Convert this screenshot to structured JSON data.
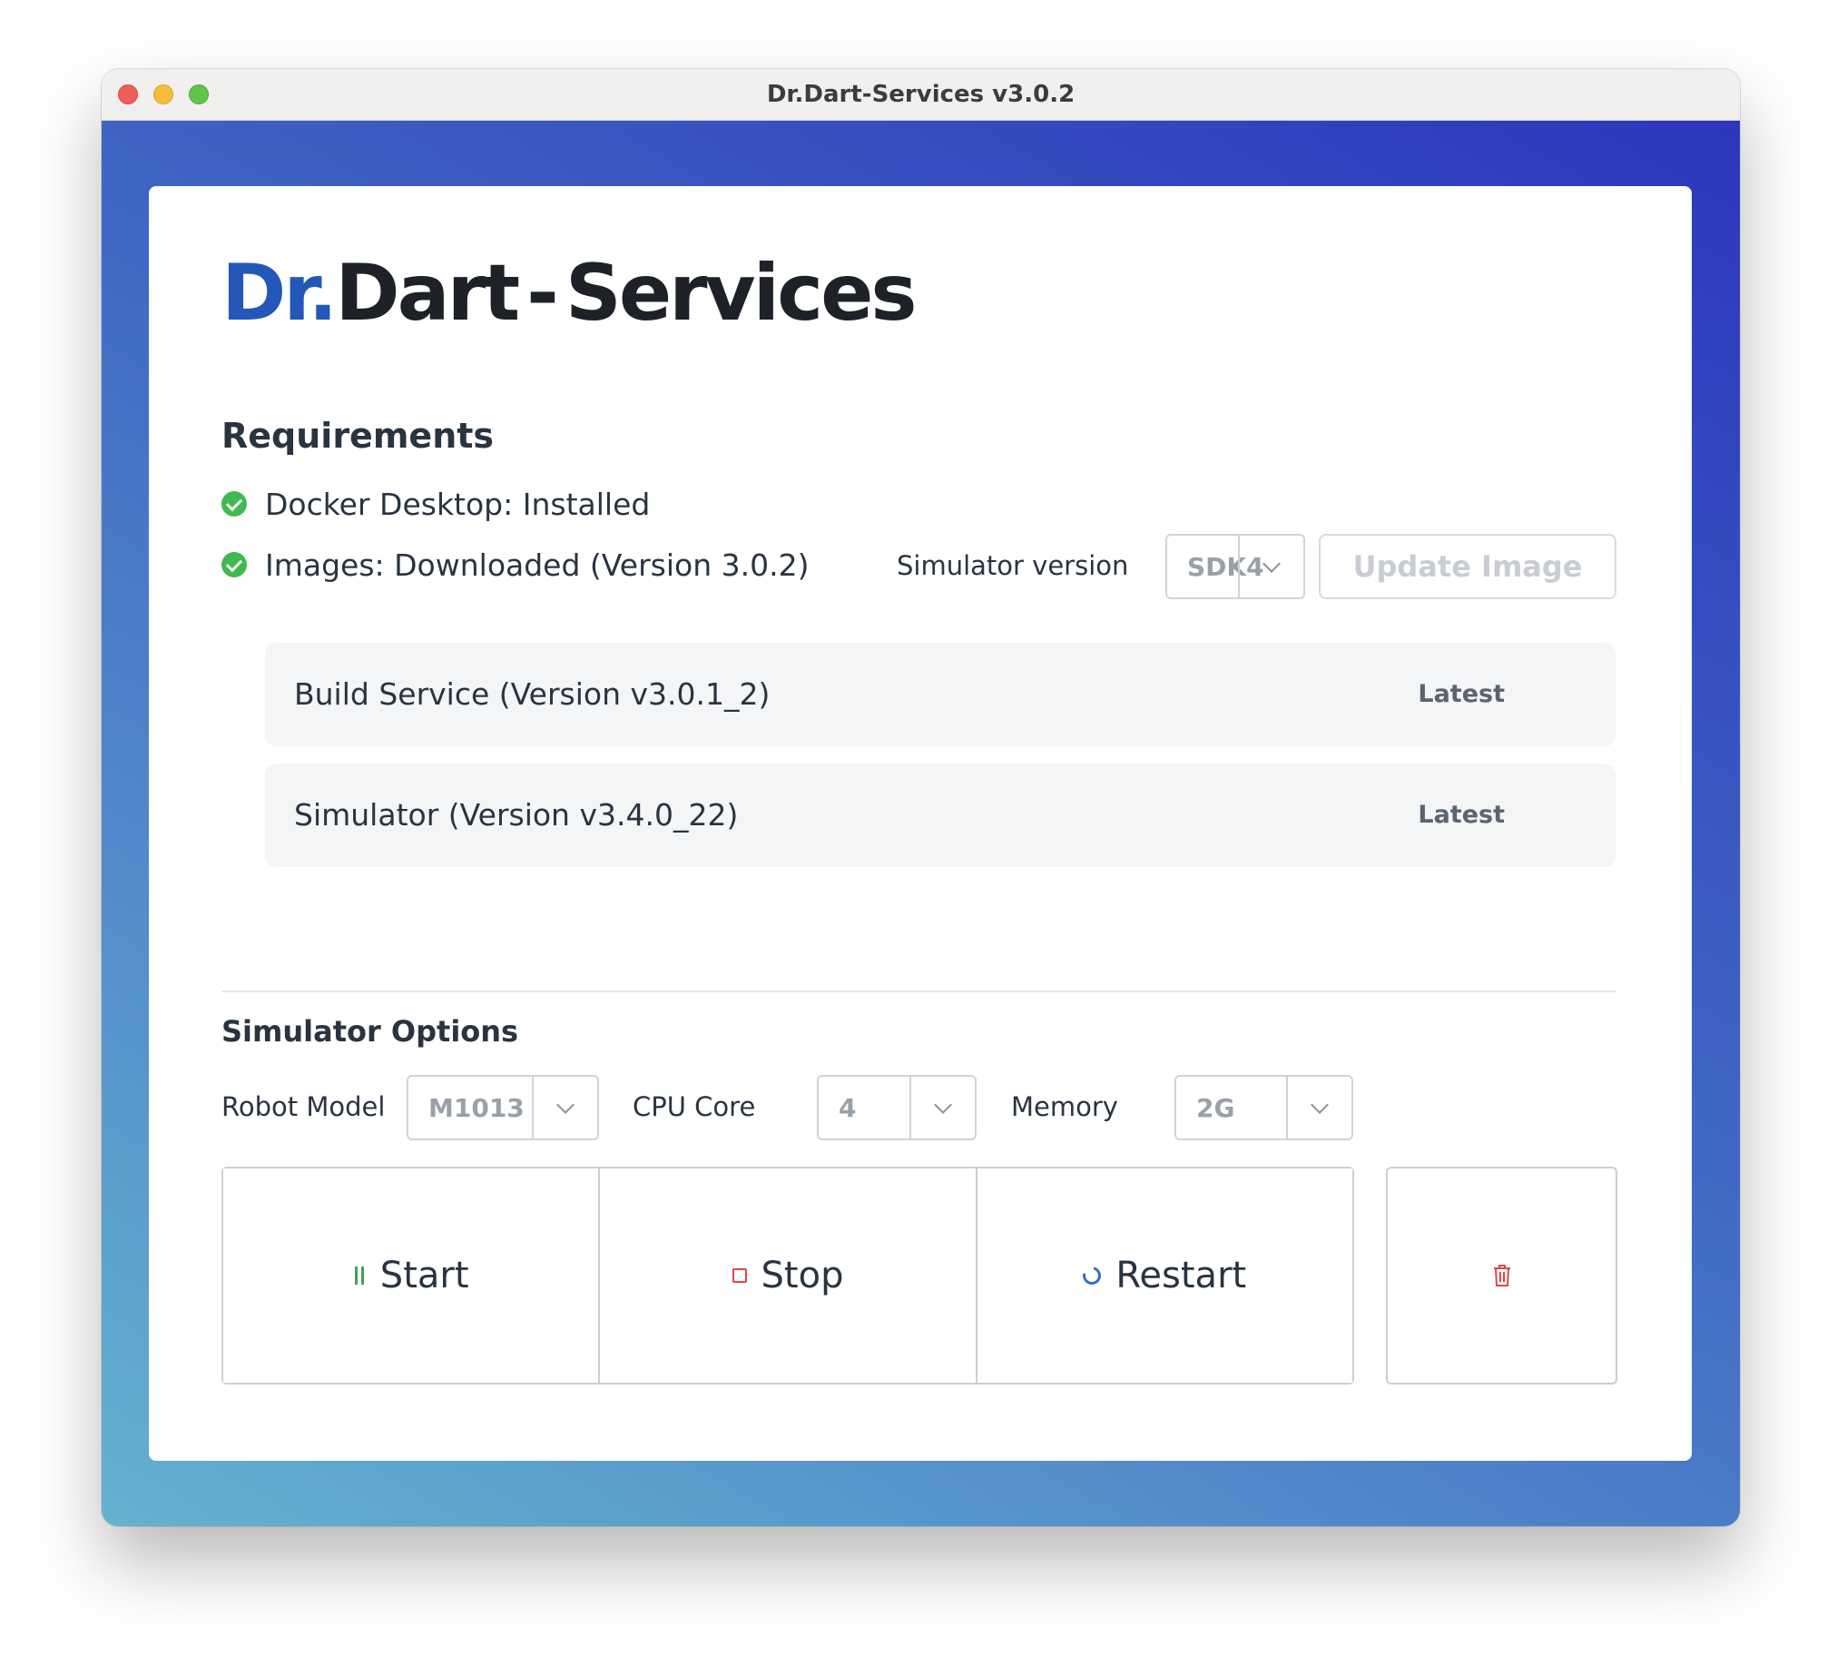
{
  "window": {
    "title": "Dr.Dart-Services v3.0.2"
  },
  "logo": {
    "part1": "Dr.",
    "part2": "Dart",
    "dash": "-",
    "part3": "Services"
  },
  "requirements": {
    "title": "Requirements",
    "items": [
      {
        "label": "Docker Desktop: Installed",
        "status": "ok"
      },
      {
        "label": "Images: Downloaded (Version 3.0.2)",
        "status": "ok"
      }
    ],
    "simulator_version_label": "Simulator version",
    "simulator_version_value": "SDK4",
    "update_button": "Update Image",
    "services": [
      {
        "name": "Build Service (Version v3.0.1_2)",
        "status": "Latest"
      },
      {
        "name": "Simulator (Version v3.4.0_22)",
        "status": "Latest"
      }
    ]
  },
  "options": {
    "title": "Simulator Options",
    "robot_model_label": "Robot Model",
    "robot_model_value": "M1013",
    "cpu_core_label": "CPU Core",
    "cpu_core_value": "4",
    "memory_label": "Memory",
    "memory_value": "2G"
  },
  "actions": {
    "start": "Start",
    "stop": "Stop",
    "restart": "Restart",
    "delete_icon": "trash-icon"
  },
  "colors": {
    "accent": "#2458b8",
    "success": "#3fb950",
    "danger": "#e04545",
    "restart": "#2f6fd0"
  }
}
